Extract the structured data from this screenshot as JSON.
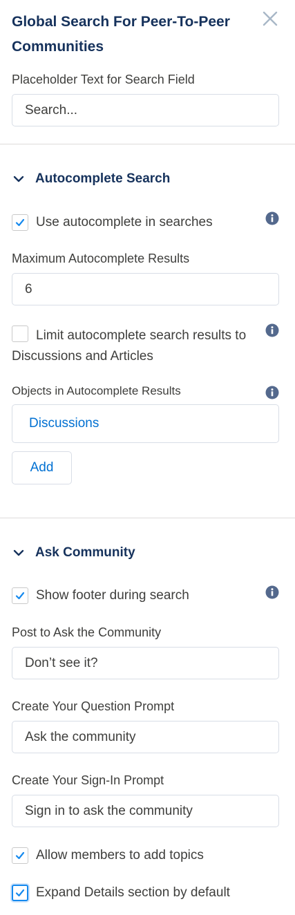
{
  "panel": {
    "title": "Global Search For Peer-To-Peer Communities",
    "close_icon": "close-icon"
  },
  "search_field": {
    "label": "Placeholder Text for Search Field",
    "value": "Search..."
  },
  "autocomplete": {
    "heading": "Autocomplete Search",
    "use_autocomplete": {
      "label": "Use autocomplete in searches",
      "checked": true
    },
    "max_results": {
      "label": "Maximum Autocomplete Results",
      "value": "6"
    },
    "limit_results": {
      "label": "Limit autocomplete search results to Discussions and Articles",
      "checked": false
    },
    "objects": {
      "label": "Objects in Autocomplete Results",
      "items": [
        "Discussions"
      ]
    },
    "add_label": "Add"
  },
  "ask_community": {
    "heading": "Ask Community",
    "show_footer": {
      "label": "Show footer during search",
      "checked": true
    },
    "post_prompt": {
      "label": "Post to Ask the Community",
      "value": "Don’t see it?"
    },
    "question_prompt": {
      "label": "Create Your Question Prompt",
      "value": "Ask the community"
    },
    "signin_prompt": {
      "label": "Create Your Sign-In Prompt",
      "value": "Sign in to ask the community"
    },
    "allow_topics": {
      "label": "Allow members to add topics",
      "checked": true
    },
    "expand_details": {
      "label": "Expand Details section by default",
      "checked": true
    }
  },
  "colors": {
    "heading": "#16325c",
    "link": "#0070d2",
    "check": "#1589ee",
    "info_icon": "#54698d"
  }
}
